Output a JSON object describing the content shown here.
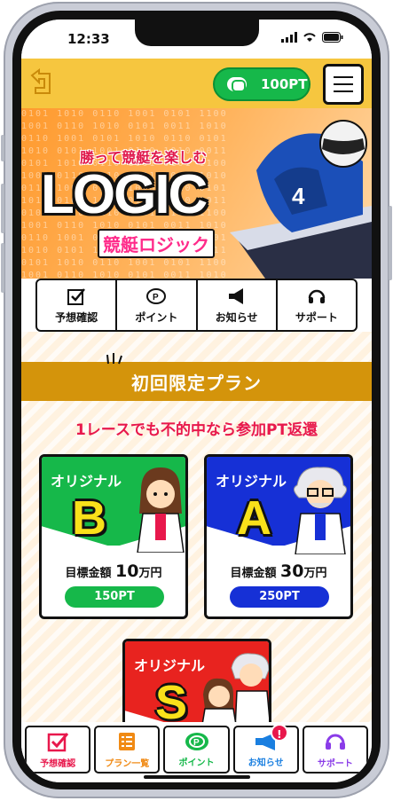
{
  "status_bar": {
    "time": "12:33"
  },
  "header": {
    "points": "100PT"
  },
  "hero": {
    "tagline": "勝って競艇を楽しむ",
    "logo": "LOGIC",
    "logo_sub": "競艇ロジック"
  },
  "quick_nav": [
    {
      "label": "予想確認",
      "icon": "check-icon"
    },
    {
      "label": "ポイント",
      "icon": "point-coin-icon"
    },
    {
      "label": "お知らせ",
      "icon": "megaphone-icon"
    },
    {
      "label": "サポート",
      "icon": "headset-icon"
    }
  ],
  "plans": {
    "banner_title": "初回限定プラン",
    "notice": "1レースでも不的中なら参加PT返還",
    "cards": [
      {
        "name": "オリジナル",
        "letter": "B",
        "target_label": "目標金額",
        "target_value": "10",
        "target_unit": "万円",
        "points": "150PT",
        "color": "#16b84a",
        "pill_color": "#16b84a"
      },
      {
        "name": "オリジナル",
        "letter": "A",
        "target_label": "目標金額",
        "target_value": "30",
        "target_unit": "万円",
        "points": "250PT",
        "color": "#1630d6",
        "pill_color": "#1630d6"
      },
      {
        "name": "オリジナル",
        "letter": "S",
        "color": "#e8231f"
      }
    ]
  },
  "tab_bar": [
    {
      "label": "予想確認",
      "icon": "check-icon",
      "color": "#e8184c"
    },
    {
      "label": "プラン一覧",
      "icon": "list-icon",
      "color": "#f08a14"
    },
    {
      "label": "ポイント",
      "icon": "point-coin-icon",
      "color": "#16b84a"
    },
    {
      "label": "お知らせ",
      "icon": "megaphone-icon",
      "color": "#1a7fe0",
      "badge": "!"
    },
    {
      "label": "サポート",
      "icon": "headset-icon",
      "color": "#8a3ce8"
    }
  ]
}
